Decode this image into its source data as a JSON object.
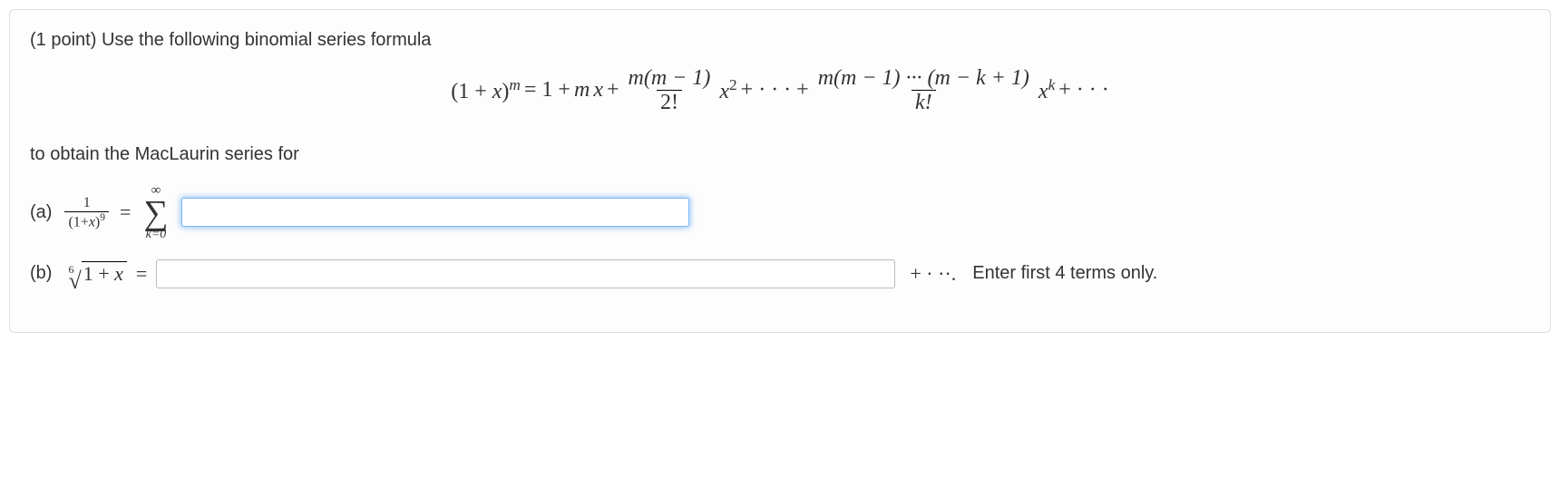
{
  "problem": {
    "points_prefix": "(1 point) ",
    "intro": "Use the following binomial series formula",
    "outro": "to obtain the MacLaurin series for"
  },
  "formula": {
    "lhs_base": "(1 + ",
    "lhs_var": "x",
    "lhs_close": ")",
    "lhs_exp": "m",
    "eq": " = 1 + ",
    "mx_m": "m",
    "mx_x": "x",
    "plus1": " + ",
    "t2_num": "m(m − 1)",
    "t2_den": "2!",
    "t2_x": "x",
    "t2_exp": "2",
    "plus_dots": " + · · · + ",
    "tk_num": "m(m − 1) ··· (m − k + 1)",
    "tk_den": "k!",
    "tk_x": "x",
    "tk_exp": "k",
    "trail": " + · · ·"
  },
  "part_a": {
    "label": "(a)",
    "frac_num": "1",
    "frac_den_base": "(1+",
    "frac_den_var": "x",
    "frac_den_close": ")",
    "frac_den_exp": "9",
    "eq": " = ",
    "sum_top": "∞",
    "sum_sigma": "∑",
    "sum_bot": "k=0",
    "value": ""
  },
  "part_b": {
    "label": "(b)",
    "root_deg": "6",
    "root_body_pre": "1 + ",
    "root_body_var": "x",
    "eq": " = ",
    "value": "",
    "trail_math": " + · ··. ",
    "trail_text": "Enter first 4 terms only."
  }
}
